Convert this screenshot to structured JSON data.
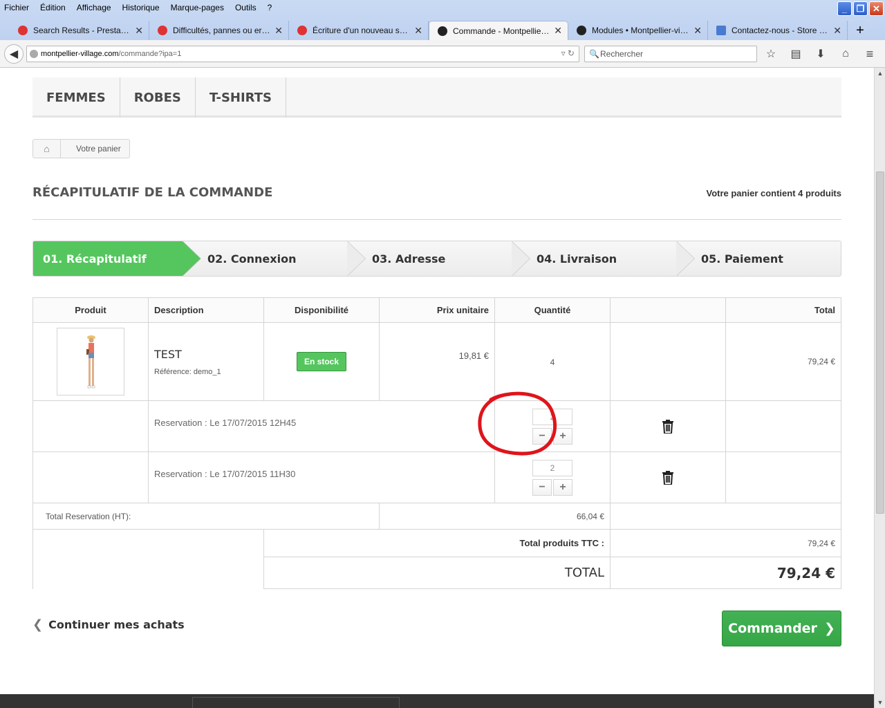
{
  "browser": {
    "menu": [
      "Fichier",
      "Édition",
      "Affichage",
      "Historique",
      "Marque-pages",
      "Outils",
      "?"
    ],
    "tabs": [
      {
        "title": "Search Results - PrestaShop",
        "active": false,
        "favicon_color": "#d33"
      },
      {
        "title": "Difficultés, pannes ou erreu...",
        "active": false,
        "favicon_color": "#d33"
      },
      {
        "title": "Écriture d'un nouveau sujet ...",
        "active": false,
        "favicon_color": "#d33"
      },
      {
        "title": "Commande - Montpellier-vill...",
        "active": true,
        "favicon_color": "#222"
      },
      {
        "title": "Modules • Montpellier-villag...",
        "active": false,
        "favicon_color": "#222"
      },
      {
        "title": "Contactez-nous - Store Opart",
        "active": false,
        "favicon_color": "#4a7bd0"
      }
    ],
    "new_tab": "+",
    "url_host": "montpellier-village.com",
    "url_path": "/commande?ipa=1",
    "search_placeholder": "Rechercher"
  },
  "site": {
    "menu": [
      "Femmes",
      "Robes",
      "T-shirts"
    ],
    "breadcrumb": "Votre panier",
    "heading": "Récapitulatif de la commande",
    "cart_count": "Votre panier contient 4 produits",
    "steps": [
      "01. Récapitulatif",
      "02. Connexion",
      "03. Adresse",
      "04. Livraison",
      "05. Paiement"
    ],
    "active_step": 0
  },
  "cart": {
    "headers": {
      "product": "Produit",
      "description": "Description",
      "availability": "Disponibilité",
      "unit_price": "Prix unitaire",
      "quantity": "Quantité",
      "delete": "",
      "total": "Total"
    },
    "item": {
      "name": "TEST",
      "reference": "Référence: demo_1",
      "availability": "En stock",
      "unit_price": "19,81 €",
      "quantity": "4",
      "total": "79,24 €"
    },
    "reservations": [
      {
        "label": "Reservation : Le 17/07/2015 12H45",
        "quantity": "2"
      },
      {
        "label": "Reservation : Le 17/07/2015 11H30",
        "quantity": "2"
      }
    ],
    "total_reservation_label": "Total Reservation (HT):",
    "total_reservation_value": "66,04 €",
    "total_products_label": "Total produits TTC :",
    "total_products_value": "79,24 €",
    "total_label": "TOTAL",
    "total_value": "79,24 €"
  },
  "actions": {
    "continue": "Continuer mes achats",
    "order": "Commander"
  },
  "colors": {
    "accent_green": "#55c65e",
    "annotation_red": "#e0141b"
  }
}
